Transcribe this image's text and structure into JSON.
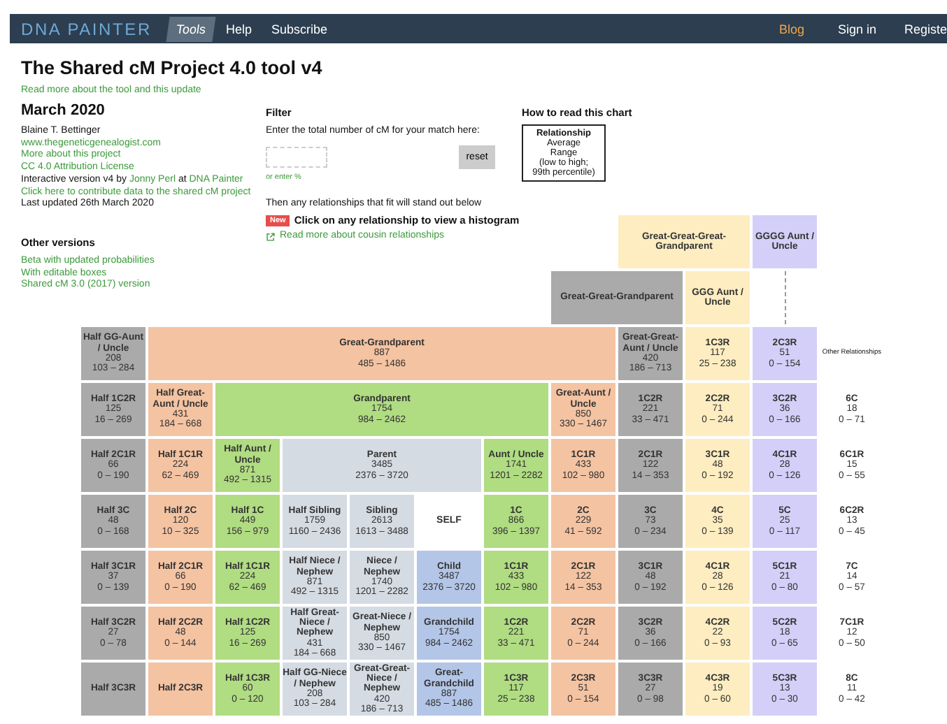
{
  "nav": {
    "logo": "DNA PAINTER",
    "tabs": [
      {
        "label": "Tools",
        "selected": true
      },
      {
        "label": "Help",
        "selected": false
      },
      {
        "label": "Subscribe",
        "selected": false
      }
    ],
    "right": [
      {
        "label": "Blog",
        "highlighted": true
      },
      {
        "label": "Sign in",
        "highlighted": false
      },
      {
        "label": "Registe",
        "highlighted": false
      }
    ]
  },
  "title": "The Shared cM Project 4.0 tool v4",
  "intro_link": "Read more about the tool and this update",
  "about": {
    "heading": "March 2020",
    "lines": [
      {
        "kind": "text",
        "text": "Blaine T. Bettinger"
      },
      {
        "kind": "link",
        "text": "www.thegeneticgenealogist.com"
      },
      {
        "kind": "link",
        "text": "More about this project"
      },
      {
        "kind": "link",
        "text": "CC 4.0 Attribution License"
      },
      {
        "kind": "credit",
        "parts": [
          "Interactive version v4 by ",
          "Jonny Perl",
          " at ",
          "DNA Painter"
        ]
      },
      {
        "kind": "link",
        "text": "Click here to contribute data to the shared cM project"
      },
      {
        "kind": "text",
        "text": "Last updated 26th March 2020"
      }
    ]
  },
  "other_versions": {
    "heading": "Other versions",
    "links": [
      "Beta with updated probabilities",
      "With editable boxes",
      "Shared cM 3.0 (2017) version"
    ]
  },
  "filter": {
    "heading": "Filter",
    "prompt": "Enter the total number of cM for your match here:",
    "reset": "reset",
    "percent_link": "or enter %",
    "hint": "Then any relationships that fit will stand out below",
    "badge": "New",
    "histogram_hint": "Click on any relationship to view a histogram",
    "cousin_link": "Read more about cousin relationships"
  },
  "legend": {
    "heading": "How to read this chart",
    "lines": [
      "Relationship",
      "Average",
      "Range",
      "(low to high;",
      "99th percentile)"
    ]
  },
  "rows": [
    [
      {
        "kind": "relationship",
        "name": "Great-Great-Great-Grandparent",
        "color": "#fdedc0"
      },
      {
        "kind": "relationship",
        "name": "GGGG Aunt / Uncle",
        "color": "#d3cff8"
      }
    ],
    [
      {
        "kind": "relationship",
        "name": "Great-Great-Grandparent",
        "color": "#aaaaaa"
      },
      {
        "kind": "relationship",
        "name": "GGG Aunt / Uncle",
        "color": "#fdedc0"
      },
      {
        "kind": "connector"
      }
    ],
    [
      {
        "kind": "relationship",
        "name": "Half GG-Aunt / Uncle",
        "avg": "208",
        "range": "103 – 284",
        "color": "#aaaaaa"
      },
      {
        "kind": "relationship",
        "name": "Great-Grandparent",
        "avg": "887",
        "range": "485 – 1486",
        "color": "#f4c3a2"
      },
      {
        "kind": "relationship",
        "name": "Great-Great-Aunt / Uncle",
        "avg": "420",
        "range": "186 – 713",
        "color": "#aaaaaa"
      },
      {
        "kind": "relationship",
        "name": "1C3R",
        "avg": "117",
        "range": "25 – 238",
        "color": "#fdedc0"
      },
      {
        "kind": "relationship",
        "name": "2C3R",
        "avg": "51",
        "range": "0 – 154",
        "color": "#d3cff8"
      },
      {
        "kind": "note",
        "name": "Other Relationships"
      }
    ],
    [
      {
        "kind": "relationship",
        "name": "Half 1C2R",
        "avg": "125",
        "range": "16 – 269",
        "color": "#aaaaaa"
      },
      {
        "kind": "relationship",
        "name": "Half Great-Aunt / Uncle",
        "avg": "431",
        "range": "184 – 668",
        "color": "#f4c3a2"
      },
      {
        "kind": "relationship",
        "name": "Grandparent",
        "avg": "1754",
        "range": "984 – 2462",
        "color": "#b0dc82"
      },
      {
        "kind": "relationship",
        "name": "Great-Aunt / Uncle",
        "avg": "850",
        "range": "330 – 1467",
        "color": "#f4c3a2"
      },
      {
        "kind": "relationship",
        "name": "1C2R",
        "avg": "221",
        "range": "33 – 471",
        "color": "#aaaaaa"
      },
      {
        "kind": "relationship",
        "name": "2C2R",
        "avg": "71",
        "range": "0 – 244",
        "color": "#fdedc0"
      },
      {
        "kind": "relationship",
        "name": "3C2R",
        "avg": "36",
        "range": "0 – 166",
        "color": "#d3cff8"
      },
      {
        "kind": "relationship",
        "name": "6C",
        "avg": "18",
        "range": "0 – 71",
        "color": "#ffffff"
      }
    ],
    [
      {
        "kind": "relationship",
        "name": "Half 2C1R",
        "avg": "66",
        "range": "0 – 190",
        "color": "#aaaaaa"
      },
      {
        "kind": "relationship",
        "name": "Half 1C1R",
        "avg": "224",
        "range": "62 – 469",
        "color": "#f4c3a2"
      },
      {
        "kind": "relationship",
        "name": "Half Aunt / Uncle",
        "avg": "871",
        "range": "492 – 1315",
        "color": "#b0dc82"
      },
      {
        "kind": "relationship",
        "name": "Parent",
        "avg": "3485",
        "range": "2376 – 3720",
        "color": "#d5dbe3"
      },
      {
        "kind": "relationship",
        "name": "Aunt / Uncle",
        "avg": "1741",
        "range": "1201 – 2282",
        "color": "#b0dc82"
      },
      {
        "kind": "relationship",
        "name": "1C1R",
        "avg": "433",
        "range": "102 – 980",
        "color": "#f4c3a2"
      },
      {
        "kind": "relationship",
        "name": "2C1R",
        "avg": "122",
        "range": "14 – 353",
        "color": "#aaaaaa"
      },
      {
        "kind": "relationship",
        "name": "3C1R",
        "avg": "48",
        "range": "0 – 192",
        "color": "#fdedc0"
      },
      {
        "kind": "relationship",
        "name": "4C1R",
        "avg": "28",
        "range": "0 – 126",
        "color": "#d3cff8"
      },
      {
        "kind": "relationship",
        "name": "6C1R",
        "avg": "15",
        "range": "0 – 55",
        "color": "#ffffff"
      }
    ],
    [
      {
        "kind": "relationship",
        "name": "Half 3C",
        "avg": "48",
        "range": "0 – 168",
        "color": "#aaaaaa"
      },
      {
        "kind": "relationship",
        "name": "Half 2C",
        "avg": "120",
        "range": "10 – 325",
        "color": "#f4c3a2"
      },
      {
        "kind": "relationship",
        "name": "Half 1C",
        "avg": "449",
        "range": "156 – 979",
        "color": "#b0dc82"
      },
      {
        "kind": "relationship",
        "name": "Half Sibling",
        "avg": "1759",
        "range": "1160 – 2436",
        "color": "#d5dbe3"
      },
      {
        "kind": "relationship",
        "name": "Sibling",
        "avg": "2613",
        "range": "1613 – 3488",
        "color": "#d5dbe3"
      },
      {
        "kind": "self",
        "name": "SELF"
      },
      {
        "kind": "relationship",
        "name": "1C",
        "avg": "866",
        "range": "396 – 1397",
        "color": "#b0dc82"
      },
      {
        "kind": "relationship",
        "name": "2C",
        "avg": "229",
        "range": "41 – 592",
        "color": "#f4c3a2"
      },
      {
        "kind": "relationship",
        "name": "3C",
        "avg": "73",
        "range": "0 – 234",
        "color": "#aaaaaa"
      },
      {
        "kind": "relationship",
        "name": "4C",
        "avg": "35",
        "range": "0 – 139",
        "color": "#fdedc0"
      },
      {
        "kind": "relationship",
        "name": "5C",
        "avg": "25",
        "range": "0 – 117",
        "color": "#d3cff8"
      },
      {
        "kind": "relationship",
        "name": "6C2R",
        "avg": "13",
        "range": "0 – 45",
        "color": "#ffffff"
      }
    ],
    [
      {
        "kind": "relationship",
        "name": "Half 3C1R",
        "avg": "37",
        "range": "0 – 139",
        "color": "#aaaaaa"
      },
      {
        "kind": "relationship",
        "name": "Half 2C1R",
        "avg": "66",
        "range": "0 – 190",
        "color": "#f4c3a2"
      },
      {
        "kind": "relationship",
        "name": "Half 1C1R",
        "avg": "224",
        "range": "62 – 469",
        "color": "#b0dc82"
      },
      {
        "kind": "relationship",
        "name": "Half Niece / Nephew",
        "avg": "871",
        "range": "492 – 1315",
        "color": "#d5dbe3"
      },
      {
        "kind": "relationship",
        "name": "Niece / Nephew",
        "avg": "1740",
        "range": "1201 – 2282",
        "color": "#d5dbe3"
      },
      {
        "kind": "relationship",
        "name": "Child",
        "avg": "3487",
        "range": "2376 – 3720",
        "color": "#b4c6e7"
      },
      {
        "kind": "relationship",
        "name": "1C1R",
        "avg": "433",
        "range": "102 – 980",
        "color": "#b0dc82"
      },
      {
        "kind": "relationship",
        "name": "2C1R",
        "avg": "122",
        "range": "14 – 353",
        "color": "#f4c3a2"
      },
      {
        "kind": "relationship",
        "name": "3C1R",
        "avg": "48",
        "range": "0 – 192",
        "color": "#aaaaaa"
      },
      {
        "kind": "relationship",
        "name": "4C1R",
        "avg": "28",
        "range": "0 – 126",
        "color": "#fdedc0"
      },
      {
        "kind": "relationship",
        "name": "5C1R",
        "avg": "21",
        "range": "0 – 80",
        "color": "#d3cff8"
      },
      {
        "kind": "relationship",
        "name": "7C",
        "avg": "14",
        "range": "0 – 57",
        "color": "#ffffff"
      }
    ],
    [
      {
        "kind": "relationship",
        "name": "Half 3C2R",
        "avg": "27",
        "range": "0 – 78",
        "color": "#aaaaaa"
      },
      {
        "kind": "relationship",
        "name": "Half 2C2R",
        "avg": "48",
        "range": "0 – 144",
        "color": "#f4c3a2"
      },
      {
        "kind": "relationship",
        "name": "Half 1C2R",
        "avg": "125",
        "range": "16 – 269",
        "color": "#b0dc82"
      },
      {
        "kind": "relationship",
        "name": "Half Great-Niece / Nephew",
        "avg": "431",
        "range": "184 – 668",
        "color": "#d5dbe3"
      },
      {
        "kind": "relationship",
        "name": "Great-Niece / Nephew",
        "avg": "850",
        "range": "330 – 1467",
        "color": "#d5dbe3"
      },
      {
        "kind": "relationship",
        "name": "Grandchild",
        "avg": "1754",
        "range": "984 – 2462",
        "color": "#b4c6e7"
      },
      {
        "kind": "relationship",
        "name": "1C2R",
        "avg": "221",
        "range": "33 – 471",
        "color": "#b0dc82"
      },
      {
        "kind": "relationship",
        "name": "2C2R",
        "avg": "71",
        "range": "0 – 244",
        "color": "#f4c3a2"
      },
      {
        "kind": "relationship",
        "name": "3C2R",
        "avg": "36",
        "range": "0 – 166",
        "color": "#aaaaaa"
      },
      {
        "kind": "relationship",
        "name": "4C2R",
        "avg": "22",
        "range": "0 – 93",
        "color": "#fdedc0"
      },
      {
        "kind": "relationship",
        "name": "5C2R",
        "avg": "18",
        "range": "0 – 65",
        "color": "#d3cff8"
      },
      {
        "kind": "relationship",
        "name": "7C1R",
        "avg": "12",
        "range": "0 – 50",
        "color": "#ffffff"
      }
    ],
    [
      {
        "kind": "relationship",
        "name": "Half 3C3R",
        "color": "#aaaaaa"
      },
      {
        "kind": "relationship",
        "name": "Half 2C3R",
        "color": "#f4c3a2"
      },
      {
        "kind": "relationship",
        "name": "Half 1C3R",
        "avg": "60",
        "range": "0 – 120",
        "color": "#b0dc82"
      },
      {
        "kind": "relationship",
        "name": "Half GG-Niece / Nephew",
        "avg": "208",
        "range": "103 – 284",
        "color": "#d5dbe3"
      },
      {
        "kind": "relationship",
        "name": "Great-Great-Niece / Nephew",
        "avg": "420",
        "range": "186 – 713",
        "color": "#d5dbe3"
      },
      {
        "kind": "relationship",
        "name": "Great-Grandchild",
        "avg": "887",
        "range": "485 – 1486",
        "color": "#b4c6e7"
      },
      {
        "kind": "relationship",
        "name": "1C3R",
        "avg": "117",
        "range": "25 – 238",
        "color": "#b0dc82"
      },
      {
        "kind": "relationship",
        "name": "2C3R",
        "avg": "51",
        "range": "0 – 154",
        "color": "#f4c3a2"
      },
      {
        "kind": "relationship",
        "name": "3C3R",
        "avg": "27",
        "range": "0 – 98",
        "color": "#aaaaaa"
      },
      {
        "kind": "relationship",
        "name": "4C3R",
        "avg": "19",
        "range": "0 – 60",
        "color": "#fdedc0"
      },
      {
        "kind": "relationship",
        "name": "5C3R",
        "avg": "13",
        "range": "0 – 30",
        "color": "#d3cff8"
      },
      {
        "kind": "relationship",
        "name": "8C",
        "avg": "11",
        "range": "0 – 42",
        "color": "#ffffff"
      }
    ]
  ]
}
